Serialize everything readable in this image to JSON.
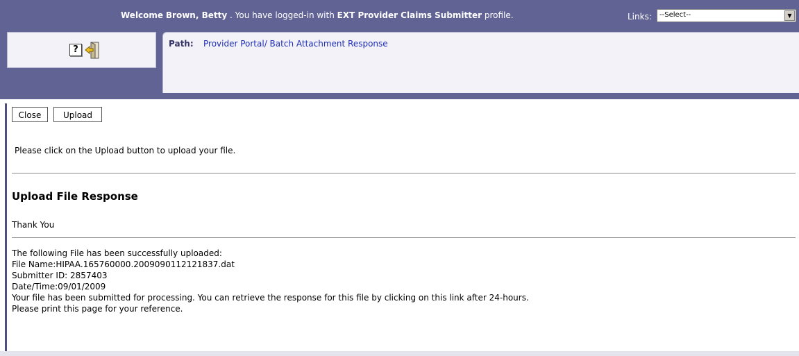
{
  "header": {
    "welcome_prefix": "Welcome",
    "user_name": "Brown, Betty",
    "welcome_middle": ". You have logged-in with",
    "profile_name": "EXT Provider Claims Submitter",
    "welcome_suffix": "profile.",
    "links_label": "Links:",
    "links_selected": "--Select--"
  },
  "toolbar": {
    "help_icon": "help-icon",
    "exit_icon": "exit-door-icon",
    "help_glyph": "?"
  },
  "path": {
    "label": "Path:",
    "value": "Provider Portal/ Batch Attachment Response"
  },
  "actions": {
    "close_label": "Close",
    "upload_label": "Upload"
  },
  "main": {
    "instruction": "Please click on the Upload button to upload your file.",
    "response_title": "Upload File Response",
    "thank_you": "Thank You",
    "details": [
      "The following File has been successfully uploaded:",
      "File Name:HIPAA.165760000.2009090112121837.dat",
      "Submitter ID: 2857403",
      "Date/Time:09/01/2009",
      "Your file has been submitted for processing. You can retrieve the response for this file by clicking on this link after 24-hours.",
      "Please print this page for your reference."
    ]
  },
  "colors": {
    "header_bg": "#616395",
    "panel_bg": "#f2f2f8",
    "link": "#1f2eb8"
  }
}
